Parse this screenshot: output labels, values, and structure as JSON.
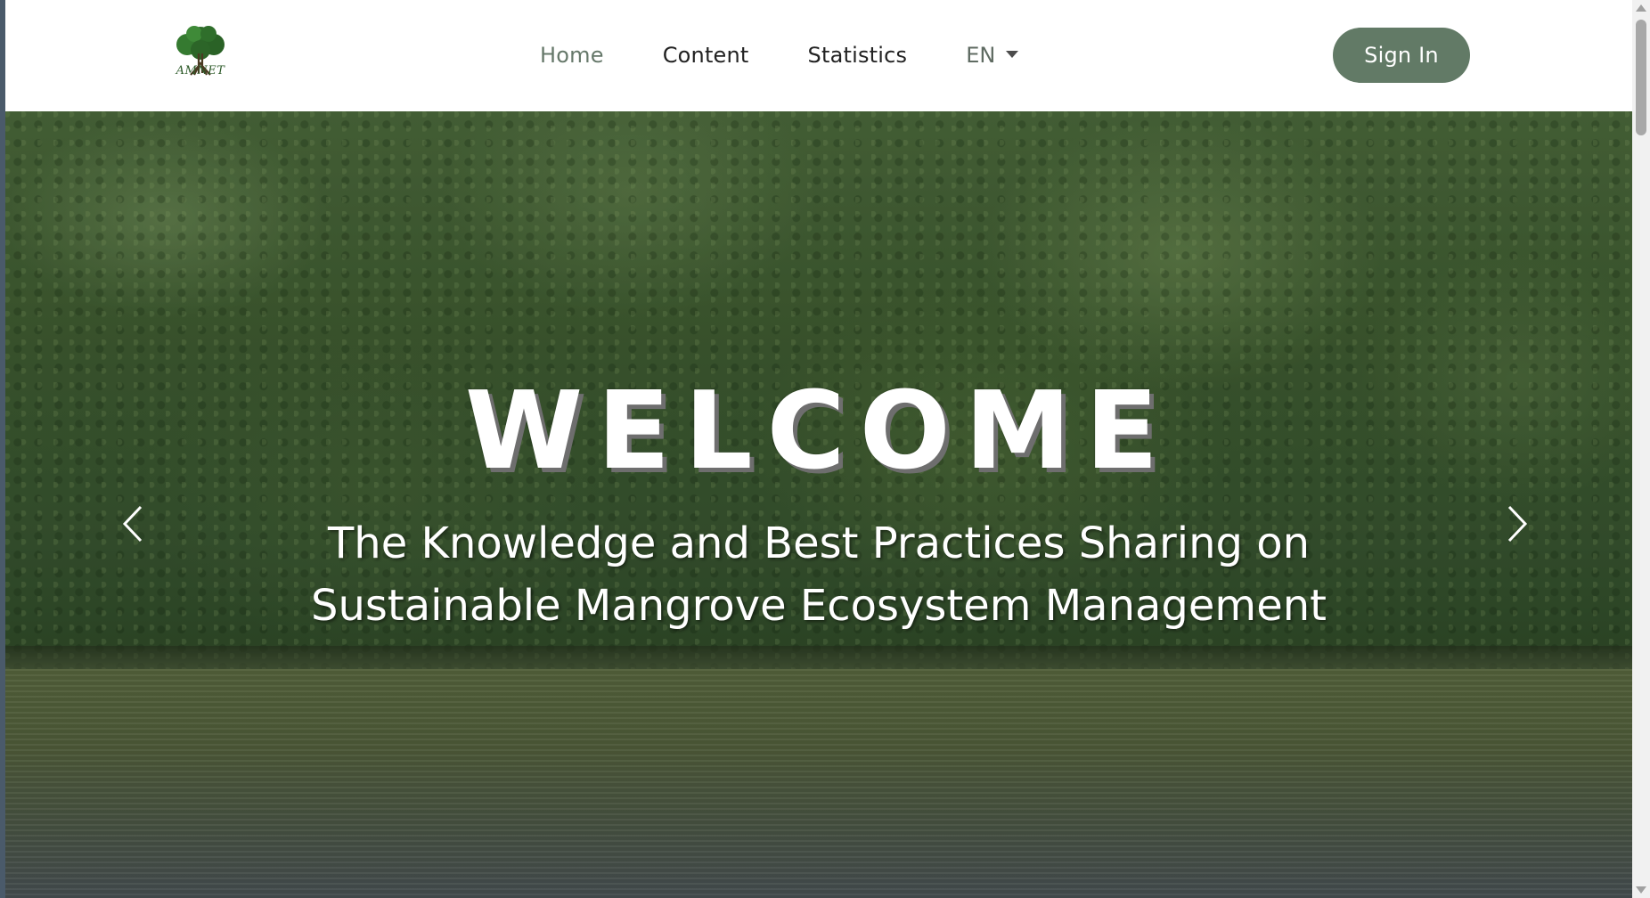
{
  "brand": {
    "logo_text": "AMNET",
    "logo_icon": "mangrove-tree-logo"
  },
  "nav": {
    "items": [
      {
        "label": "Home",
        "active": true
      },
      {
        "label": "Content",
        "active": false
      },
      {
        "label": "Statistics",
        "active": false
      }
    ],
    "language": {
      "selected": "EN",
      "icon": "caret-down-icon"
    },
    "signin_label": "Sign In"
  },
  "hero": {
    "title": "WELCOME",
    "subtitle_line1": "The Knowledge and Best Practices Sharing on",
    "subtitle_line2": "Sustainable Mangrove Ecosystem Management",
    "prev_icon": "chevron-left-icon",
    "next_icon": "chevron-right-icon"
  },
  "colors": {
    "accent": "#627a66",
    "active_nav": "#66786a",
    "nav_text": "#222222",
    "logo_green": "#2e5b2a"
  }
}
